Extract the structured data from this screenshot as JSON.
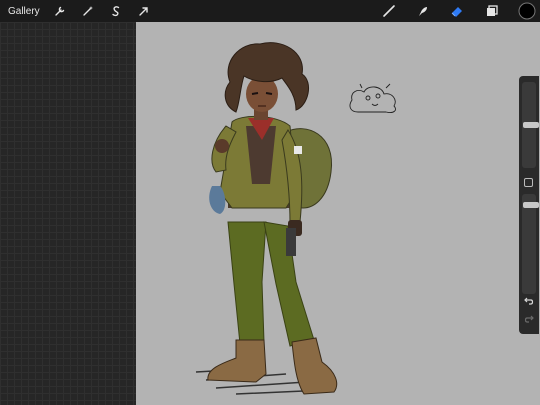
{
  "toolbar": {
    "gallery_label": "Gallery",
    "left_tools": [
      "wrench-icon",
      "magic-wand-icon",
      "selection-icon",
      "transform-icon"
    ],
    "right_tools": [
      "brush-icon",
      "smudge-icon",
      "eraser-icon",
      "layers-icon",
      "color-swatch"
    ],
    "active_tool": "eraser-icon",
    "accent_color": "#2f7bf5",
    "current_color": "#000000"
  },
  "canvas": {
    "background": "#b3b3b3",
    "subject": "girl-with-curly-hair-in-green-jacket-and-cargo-pants"
  },
  "sidebar": {
    "brush_size_level": 0.2,
    "opacity_level": 0.5,
    "buttons": [
      "modify-button",
      "undo-icon",
      "redo-icon"
    ]
  }
}
